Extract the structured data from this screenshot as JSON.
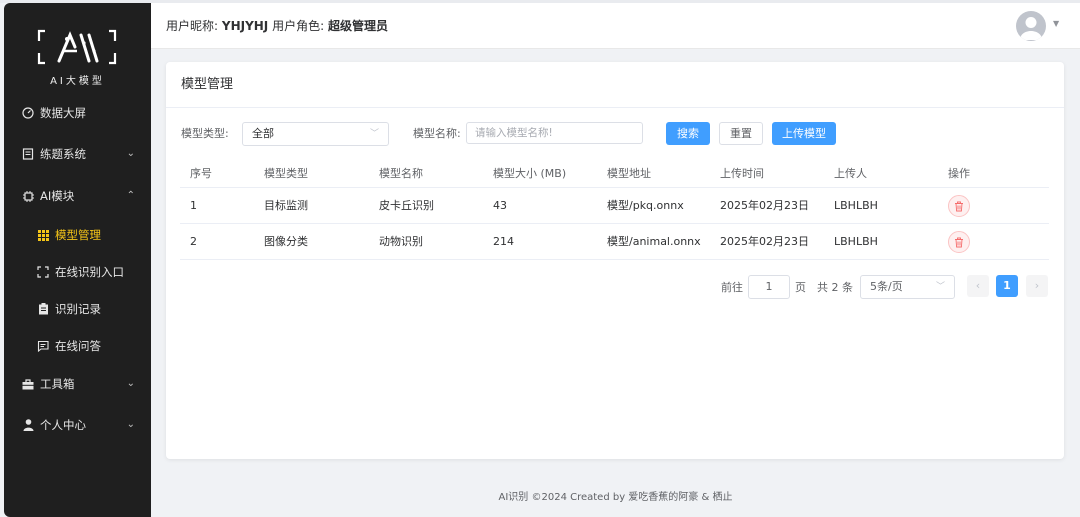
{
  "brand": {
    "logo_text": "AI大模型"
  },
  "sidebar": {
    "items": [
      {
        "label": "数据大屏",
        "icon": "dashboard-icon"
      },
      {
        "label": "练题系统",
        "icon": "notebook-icon"
      },
      {
        "label": "AI模块",
        "icon": "ai-chip-icon"
      },
      {
        "label": "模型管理",
        "icon": "grid-icon"
      },
      {
        "label": "在线识别入口",
        "icon": "scan-icon"
      },
      {
        "label": "识别记录",
        "icon": "clipboard-icon"
      },
      {
        "label": "在线问答",
        "icon": "chat-icon"
      },
      {
        "label": "工具箱",
        "icon": "toolbox-icon"
      },
      {
        "label": "个人中心",
        "icon": "user-icon"
      }
    ]
  },
  "header": {
    "nickname_label": "用户昵称:",
    "nickname": "YHJYHJ",
    "role_label": "用户角色:",
    "role": "超级管理员"
  },
  "card": {
    "title": "模型管理"
  },
  "filters": {
    "type_label": "模型类型:",
    "type_value": "全部",
    "name_label": "模型名称:",
    "name_placeholder": "请输入模型名称!",
    "search_btn": "搜索",
    "reset_btn": "重置",
    "upload_btn": "上传模型"
  },
  "table": {
    "headers": [
      "序号",
      "模型类型",
      "模型名称",
      "模型大小 (MB)",
      "模型地址",
      "上传时间",
      "上传人",
      "操作"
    ],
    "rows": [
      [
        "1",
        "目标监测",
        "皮卡丘识别",
        "43",
        "模型/pkq.onnx",
        "2025年02月23日",
        "LBHLBH"
      ],
      [
        "2",
        "图像分类",
        "动物识别",
        "214",
        "模型/animal.onnx",
        "2025年02月23日",
        "LBHLBH"
      ]
    ]
  },
  "pagination": {
    "goto_label": "前往",
    "goto_value": "1",
    "page_suffix": "页",
    "total": "共 2 条",
    "page_size": "5条/页",
    "current_page": "1",
    "prev": "‹",
    "next": "›"
  },
  "footer": {
    "text": "AI识别 ©2024 Created by 爱吃香蕉的阿豪 & 栖止"
  },
  "colors": {
    "primary": "#409eff",
    "sidebar_bg": "#1f1f1f",
    "active_menu": "#f5c518",
    "danger": "#f56c6c"
  }
}
